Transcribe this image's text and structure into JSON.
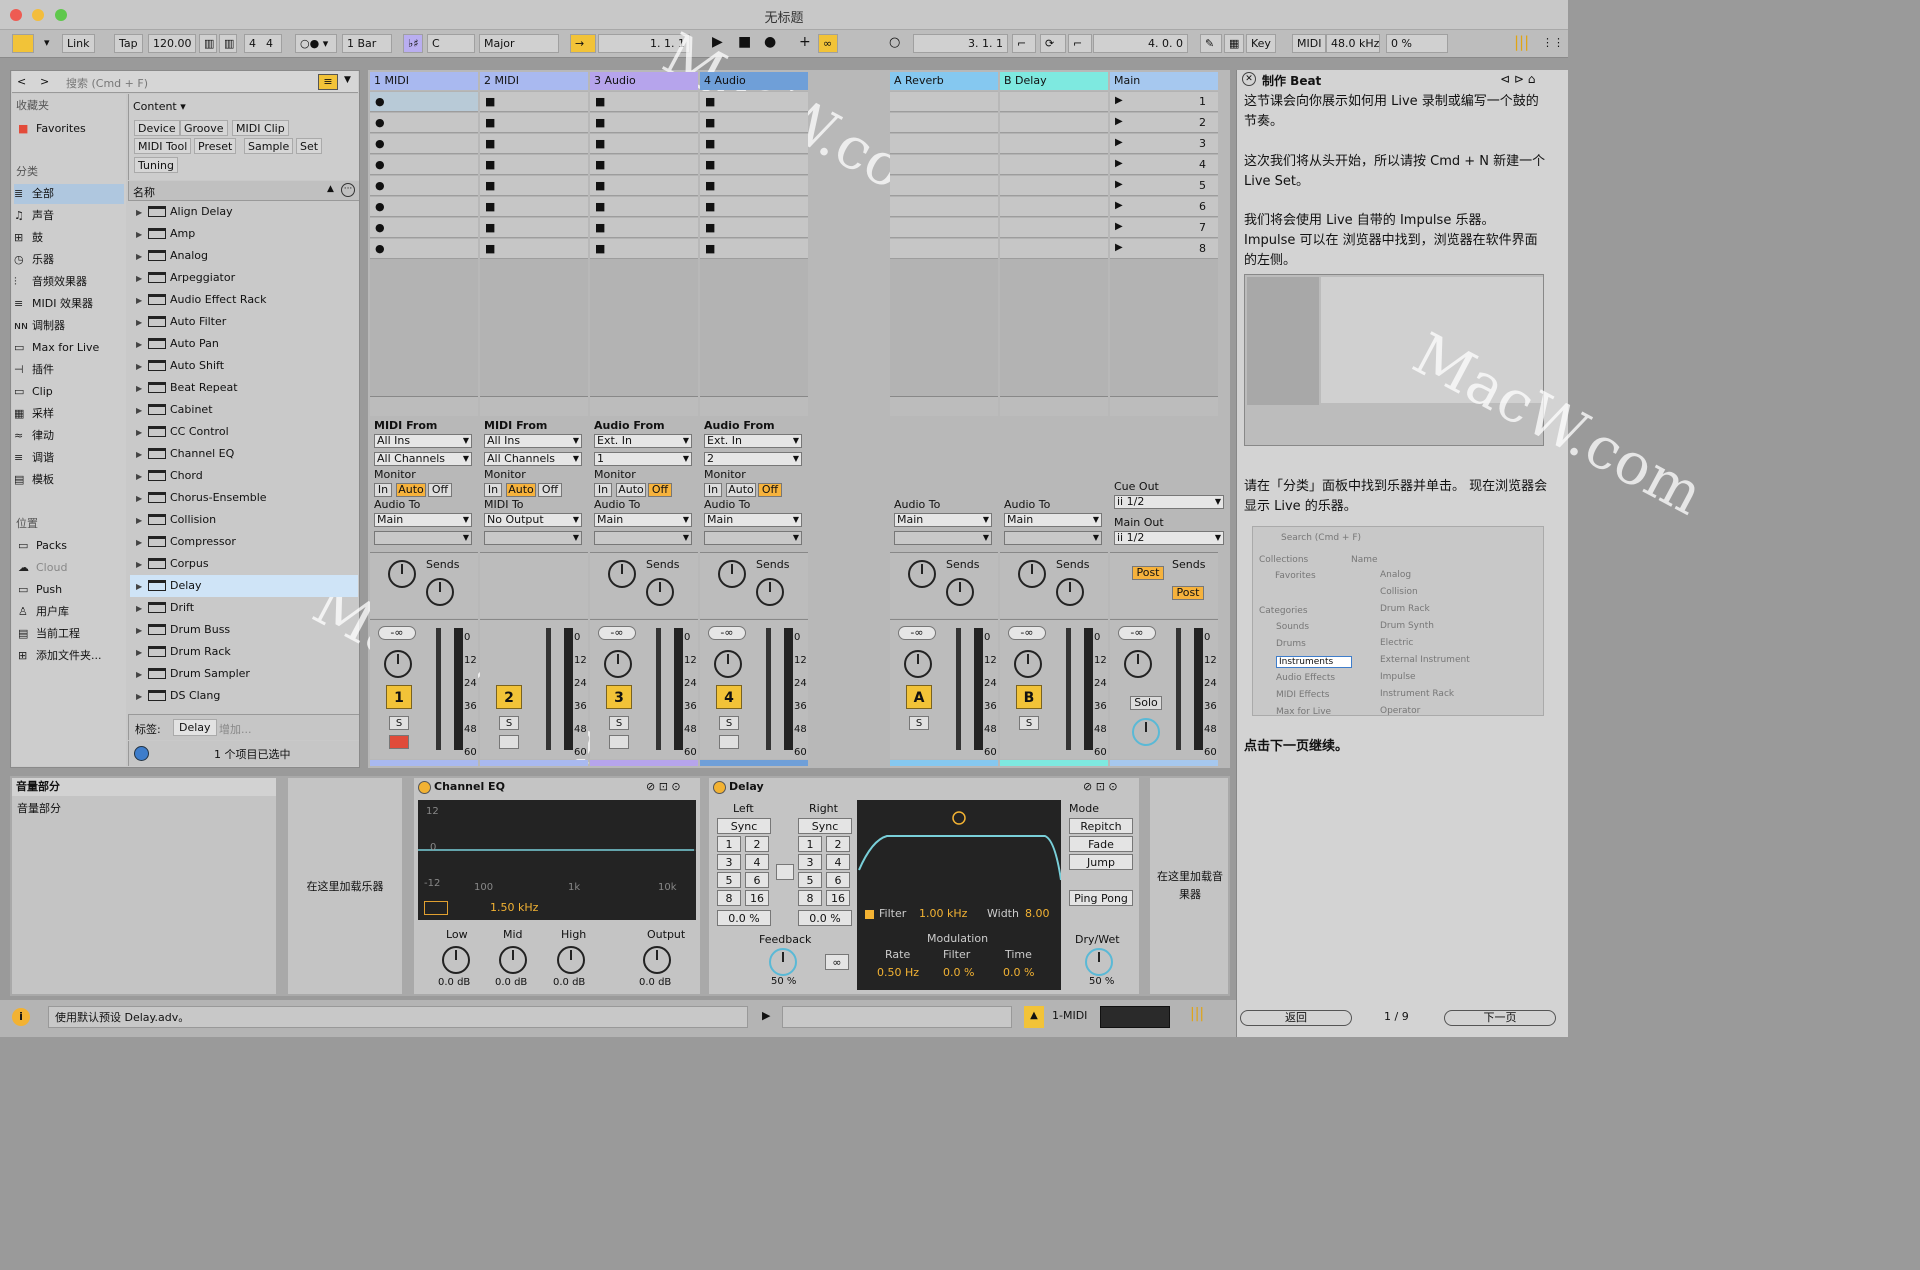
{
  "window": {
    "title": "无标题"
  },
  "toolbar": {
    "link": "Link",
    "tap": "Tap",
    "tempo": "120.00",
    "signature_num": "4",
    "signature_den": "4",
    "quant": "1 Bar",
    "key": "C",
    "scale": "Major",
    "arr_pos": "1.   1.   1",
    "loop_start": "3.   1.   1",
    "loop_len": "4.   0.   0",
    "key_btn": "Key",
    "midi_btn": "MIDI",
    "samplerate": "48.0 kHz",
    "cpu": "0 %"
  },
  "browser": {
    "search_placeholder": "搜索 (Cmd + F)",
    "collections_label": "收藏夹",
    "favorites": "Favorites",
    "categories_label": "分类",
    "categories": [
      "全部",
      "声音",
      "鼓",
      "乐器",
      "音频效果器",
      "MIDI 效果器",
      "调制器",
      "Max for Live",
      "插件",
      "Clip",
      "采样",
      "律动",
      "调谐",
      "模板"
    ],
    "places_label": "位置",
    "places": [
      "Packs",
      "Cloud",
      "Push",
      "用户库",
      "当前工程",
      "添加文件夹..."
    ],
    "content_label": "Content ▾",
    "filters": [
      "Device",
      "Groove",
      "MIDI Clip",
      "MIDI Tool",
      "Preset",
      "Sample",
      "Set",
      "Tuning"
    ],
    "name_header": "名称",
    "items": [
      "Align Delay",
      "Amp",
      "Analog",
      "Arpeggiator",
      "Audio Effect Rack",
      "Auto Filter",
      "Auto Pan",
      "Auto Shift",
      "Beat Repeat",
      "Cabinet",
      "CC Control",
      "Channel EQ",
      "Chord",
      "Chorus-Ensemble",
      "Collision",
      "Compressor",
      "Corpus",
      "Delay",
      "Drift",
      "Drum Buss",
      "Drum Rack",
      "Drum Sampler",
      "DS Clang"
    ],
    "selected_item": "Delay",
    "tags_label": "标签:",
    "tag_value": "Delay",
    "tag_add": "增加...",
    "status": "1 个项目已选中"
  },
  "tracks": [
    {
      "name": "1 MIDI",
      "color": "#a9b9f0",
      "num": "1",
      "from_label": "MIDI From",
      "from": "All Ins",
      "chan": "All Channels",
      "to": "Main"
    },
    {
      "name": "2 MIDI",
      "color": "#a9b9f0",
      "num": "2",
      "from_label": "MIDI From",
      "from": "All Ins",
      "chan": "All Channels",
      "to": "No Output",
      "to_label": "MIDI To"
    },
    {
      "name": "3 Audio",
      "color": "#b6a4ec",
      "num": "3",
      "from_label": "Audio From",
      "from": "Ext. In",
      "chan": "1",
      "to": "Main"
    },
    {
      "name": "4 Audio",
      "color": "#6f9fd8",
      "num": "4",
      "from_label": "Audio From",
      "from": "Ext. In",
      "chan": "2",
      "to": "Main"
    }
  ],
  "returns": [
    {
      "name": "A Reverb",
      "color": "#85c8f0",
      "num": "A",
      "to": "Main"
    },
    {
      "name": "B Delay",
      "color": "#7ee9e0",
      "num": "B",
      "to": "Main"
    }
  ],
  "main": {
    "name": "Main",
    "scenes": [
      "1",
      "2",
      "3",
      "4",
      "5",
      "6",
      "7",
      "8"
    ],
    "cue_label": "Cue Out",
    "cue": "ii 1/2",
    "main_out_label": "Main Out",
    "main_out": "ii 1/2",
    "solo": "Solo",
    "post": "Post"
  },
  "mixer": {
    "monitor": "Monitor",
    "in": "In",
    "auto": "Auto",
    "off": "Off",
    "audio_to": "Audio To",
    "sends": "Sends",
    "vol": "-∞",
    "scale": [
      "0",
      "12",
      "24",
      "36",
      "48",
      "60"
    ],
    "s": "S",
    "a": "A",
    "b": "B"
  },
  "devices": {
    "left_panel_title": "音量部分",
    "left_panel_sub": "音量部分",
    "load_instrument": "在这里加载乐器",
    "load_effect": "在这里加载音果器",
    "eq": {
      "title": "Channel EQ",
      "y_top": "12",
      "y_mid": "0",
      "y_bot": "-12",
      "f1": "100",
      "f2": "1k",
      "f3": "10k",
      "freq": "1.50 kHz",
      "low": "Low",
      "mid": "Mid",
      "high": "High",
      "output": "Output",
      "low_v": "0.0 dB",
      "mid_v": "0.0 dB",
      "high_v": "0.0 dB",
      "out_v": "0.0 dB"
    },
    "delay": {
      "title": "Delay",
      "left": "Left",
      "right": "Right",
      "sync": "Sync",
      "grid": [
        "1",
        "2",
        "3",
        "4",
        "5",
        "6",
        "8",
        "16"
      ],
      "left_off": "0.0 %",
      "right_off": "0.0 %",
      "feedback": "Feedback",
      "feedback_v": "50 %",
      "filter": "Filter",
      "filter_freq": "1.00 kHz",
      "width_label": "Width",
      "width": "8.00",
      "modulation": "Modulation",
      "rate_l": "Rate",
      "filter_l": "Filter",
      "time_l": "Time",
      "rate": "0.50 Hz",
      "mod_filter": "0.0 %",
      "mod_time": "0.0 %",
      "mode": "Mode",
      "repitch": "Repitch",
      "fade": "Fade",
      "jump": "Jump",
      "pingpong": "Ping Pong",
      "drywet": "Dry/Wet",
      "drywet_v": "50 %"
    }
  },
  "statusbar": {
    "message": "使用默认预设 Delay.adv。",
    "track": "1-MIDI"
  },
  "lesson": {
    "title": "制作 Beat",
    "p1": "这节课会向你展示如何用 Live 录制或编写一个鼓的节奏。",
    "p2": "这次我们将从头开始，所以请按 Cmd + N 新建一个 Live Set。",
    "p3a": "我们将会使用 Live 自带的 Impulse 乐器。",
    "p3b": "Impulse 可以在 浏览器中找到，浏览器在软件界面的左侧。",
    "p4": "请在「分类」面板中找到乐器并单击。 现在浏览器会显示 Live 的乐器。",
    "p5": "点击下一页继续。",
    "back": "返回",
    "page": "1 / 9",
    "next": "下一页",
    "mini": {
      "search": "Search (Cmd + F)",
      "collections": "Collections",
      "favorites": "Favorites",
      "categories": "Categories",
      "cats": [
        "Sounds",
        "Drums",
        "Instruments",
        "Audio Effects",
        "MIDI Effects",
        "Max for Live"
      ],
      "name": "Name",
      "items": [
        "Analog",
        "Collision",
        "Drum Rack",
        "Drum Synth",
        "Electric",
        "External Instrument",
        "Impulse",
        "Instrument Rack",
        "Operator"
      ]
    }
  },
  "watermark": "MacW.com"
}
